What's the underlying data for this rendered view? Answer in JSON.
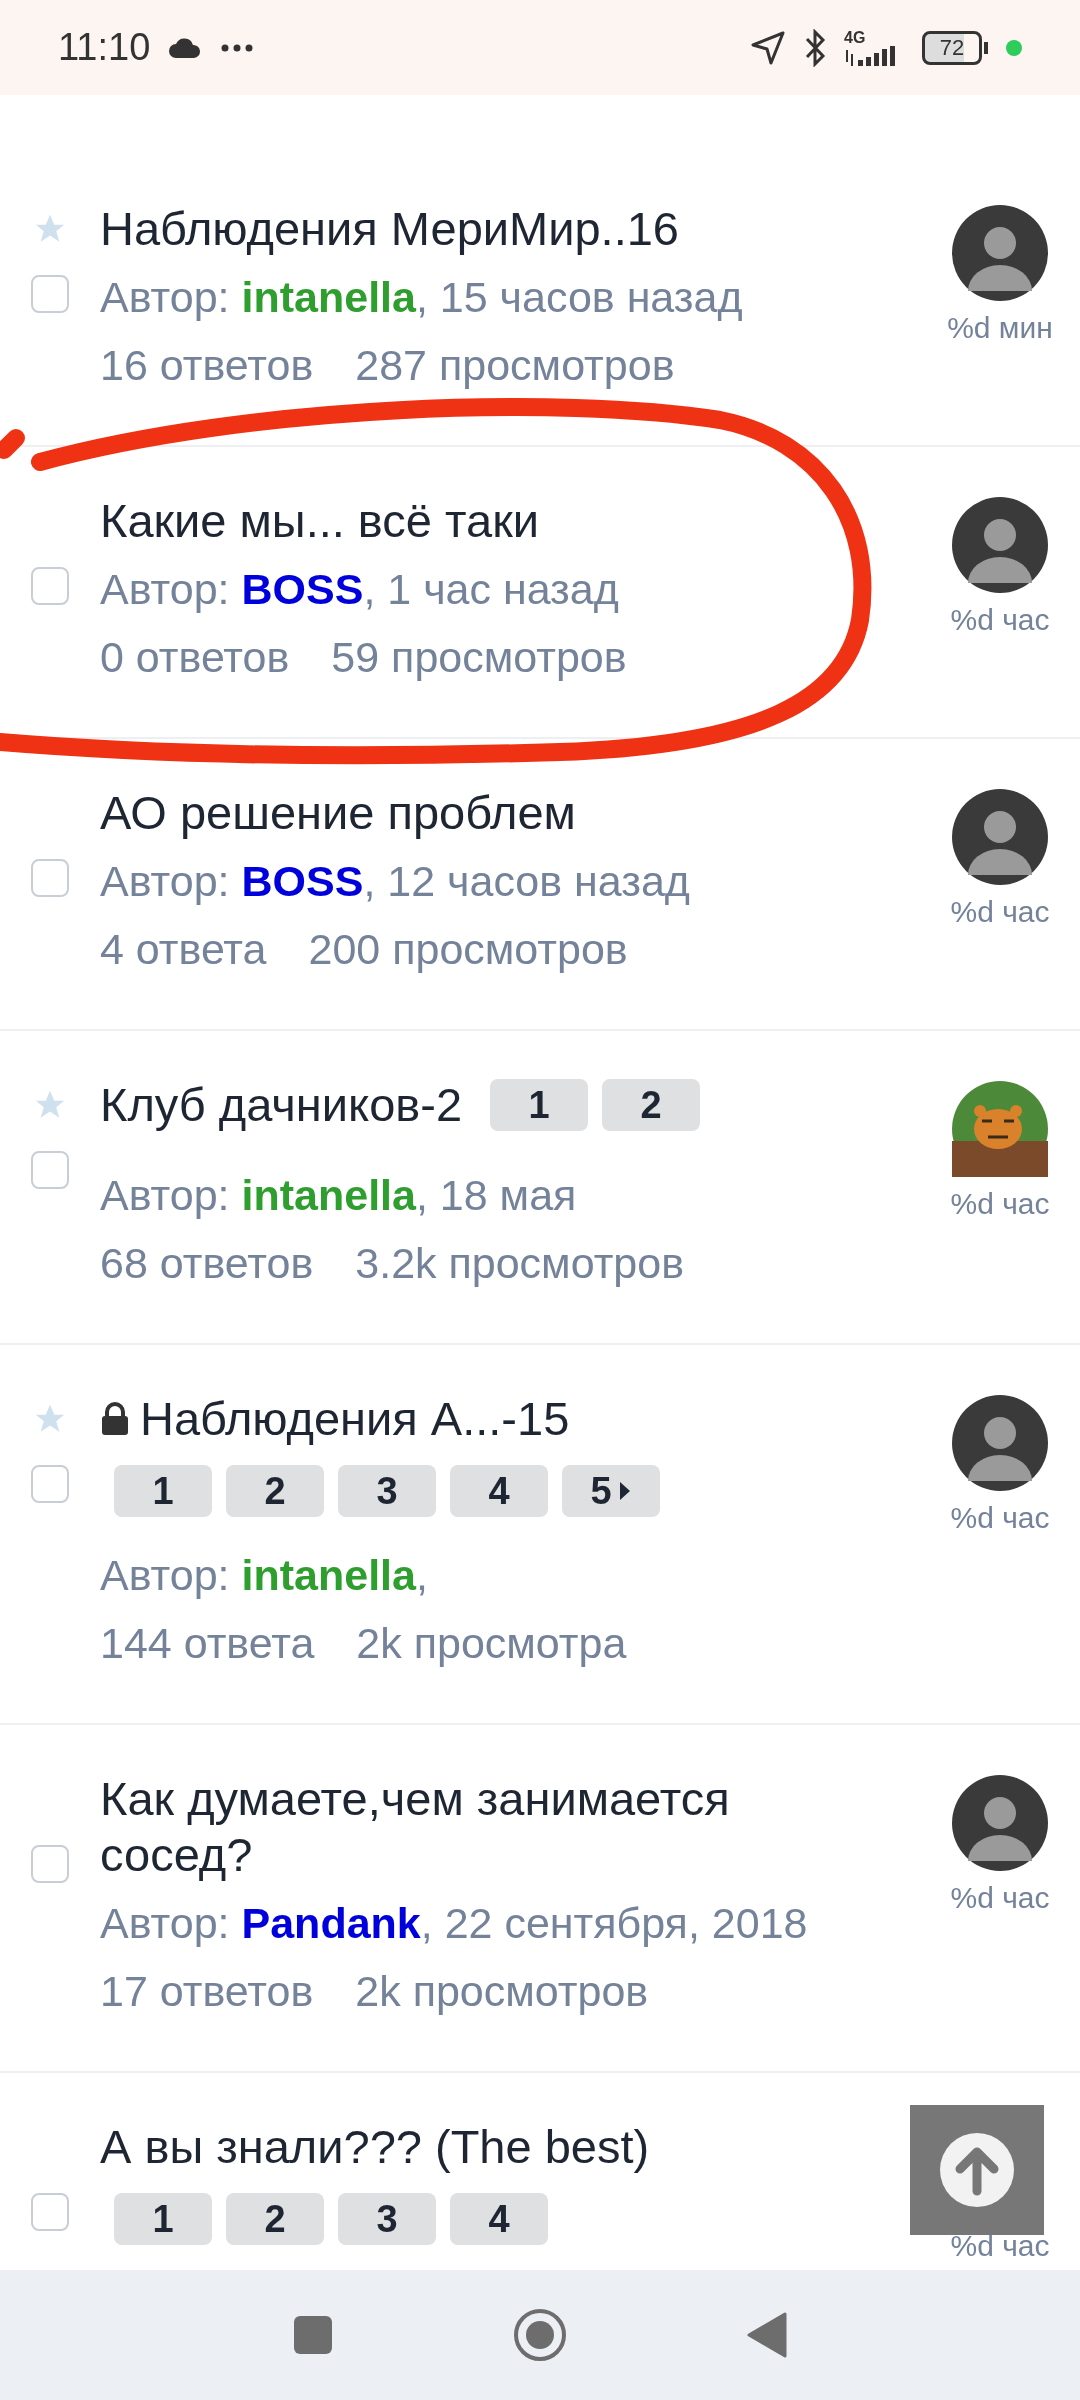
{
  "status_bar": {
    "time": "11:10",
    "network": "4G",
    "battery": "72"
  },
  "topics": [
    {
      "title": "Наблюдения МериМир..16",
      "starred": true,
      "locked": false,
      "checked": false,
      "author_label": "Автор:",
      "author": {
        "name": "intanella",
        "color": "#2e9e2e"
      },
      "date": ", 15 часов назад",
      "replies": "16 ответов",
      "views": "287 просмотров",
      "avatar": {
        "kind": "person"
      },
      "last_post": "%d мин"
    },
    {
      "title": "Какие мы... всё таки",
      "starred": false,
      "locked": false,
      "checked": false,
      "author_label": "Автор:",
      "author": {
        "name": "BOSS",
        "color": "#0000dd"
      },
      "date": ", 1 час назад",
      "replies": "0 ответов",
      "views": "59 просмотров",
      "avatar": {
        "kind": "person"
      },
      "last_post": "%d час"
    },
    {
      "title": "АО решение проблем",
      "starred": false,
      "locked": false,
      "checked": false,
      "author_label": "Автор:",
      "author": {
        "name": "BOSS",
        "color": "#0000dd"
      },
      "date": ", 12 часов назад",
      "replies": "4 ответа",
      "views": "200 просмотров",
      "avatar": {
        "kind": "person"
      },
      "last_post": "%d час"
    },
    {
      "title": "Клуб дачников-2",
      "starred": true,
      "locked": false,
      "checked": false,
      "pages_inline": true,
      "pages": [
        "1",
        "2"
      ],
      "more_pages": false,
      "author_label": "Автор:",
      "author": {
        "name": "intanella",
        "color": "#2e9e2e"
      },
      "date": ", 18 мая",
      "replies": "68 ответов",
      "views": "3.2k просмотров",
      "last_post": "%d час"
    },
    {
      "title": "Наблюдения А...-15",
      "starred": true,
      "locked": true,
      "checked": false,
      "pages_inline": false,
      "pages": [
        "1",
        "2",
        "3",
        "4",
        "5"
      ],
      "more_pages": true,
      "author_label": "Автор:",
      "author": {
        "name": "intanella",
        "color": "#2e9e2e"
      },
      "date": ",",
      "replies": "144 ответа",
      "views": "2k просмотра",
      "avatar": {
        "kind": "person"
      },
      "last_post": "%d час"
    },
    {
      "title": "Как думаете,чем занимается сосед?",
      "starred": false,
      "locked": false,
      "checked": false,
      "author_label": "Автор:",
      "author": {
        "name": "Pandank",
        "color": "#0000dd"
      },
      "date": ", 22 сентября, 2018",
      "replies": "17 ответов",
      "views": "2k просмотров",
      "avatar": {
        "kind": "person"
      },
      "last_post": "%d час"
    },
    {
      "title": "А вы знали??? (The best)",
      "starred": false,
      "locked": false,
      "checked": false,
      "pages_inline": false,
      "pages": [
        "1",
        "2",
        "3",
        "4"
      ],
      "more_pages": false,
      "last_post": "%d час"
    }
  ]
}
